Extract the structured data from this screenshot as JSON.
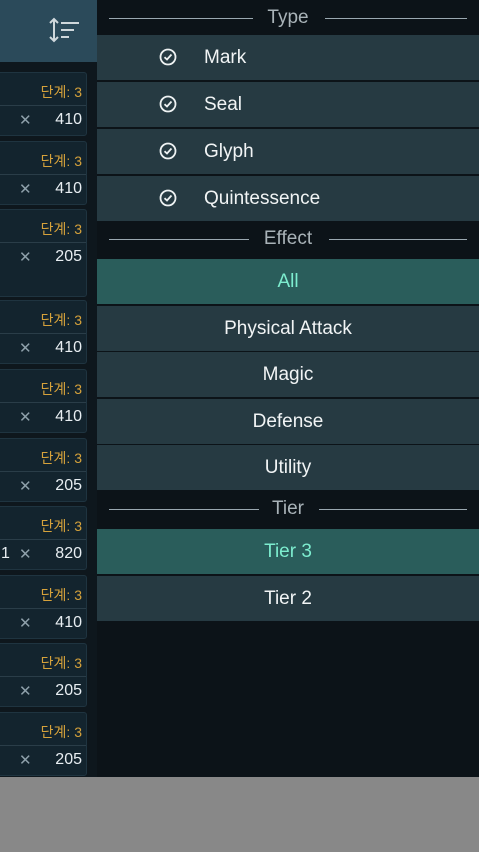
{
  "list": {
    "cards": [
      {
        "tier": "단계: 3",
        "cost": "410",
        "prefix": ""
      },
      {
        "tier": "단계: 3",
        "cost": "410",
        "prefix": ""
      },
      {
        "tier": "단계: 3",
        "cost": "205",
        "prefix": ""
      },
      {
        "tier": "단계: 3",
        "cost": "410",
        "prefix": ""
      },
      {
        "tier": "단계: 3",
        "cost": "410",
        "prefix": ""
      },
      {
        "tier": "단계: 3",
        "cost": "205",
        "prefix": ""
      },
      {
        "tier": "단계: 3",
        "cost": "820",
        "prefix": "1"
      },
      {
        "tier": "단계: 3",
        "cost": "410",
        "prefix": ""
      },
      {
        "tier": "단계: 3",
        "cost": "205",
        "prefix": ""
      },
      {
        "tier": "단계: 3",
        "cost": "205",
        "prefix": ""
      }
    ],
    "cross_glyph": "✕"
  },
  "filters": {
    "type": {
      "title": "Type",
      "items": [
        {
          "label": "Mark",
          "checked": true
        },
        {
          "label": "Seal",
          "checked": true
        },
        {
          "label": "Glyph",
          "checked": true
        },
        {
          "label": "Quintessence",
          "checked": true
        }
      ]
    },
    "effect": {
      "title": "Effect",
      "items": [
        {
          "label": "All",
          "selected": true
        },
        {
          "label": "Physical Attack",
          "selected": false
        },
        {
          "label": "Magic",
          "selected": false
        },
        {
          "label": "Defense",
          "selected": false
        },
        {
          "label": "Utility",
          "selected": false
        }
      ]
    },
    "tier": {
      "title": "Tier",
      "items": [
        {
          "label": "Tier 3",
          "selected": true
        },
        {
          "label": "Tier 2",
          "selected": false
        }
      ]
    }
  },
  "colors": {
    "tier_text": "#d6a23b",
    "selected_bg": "#2a5d5b",
    "selected_text": "#7dedcf",
    "row_bg": "#263a42"
  }
}
